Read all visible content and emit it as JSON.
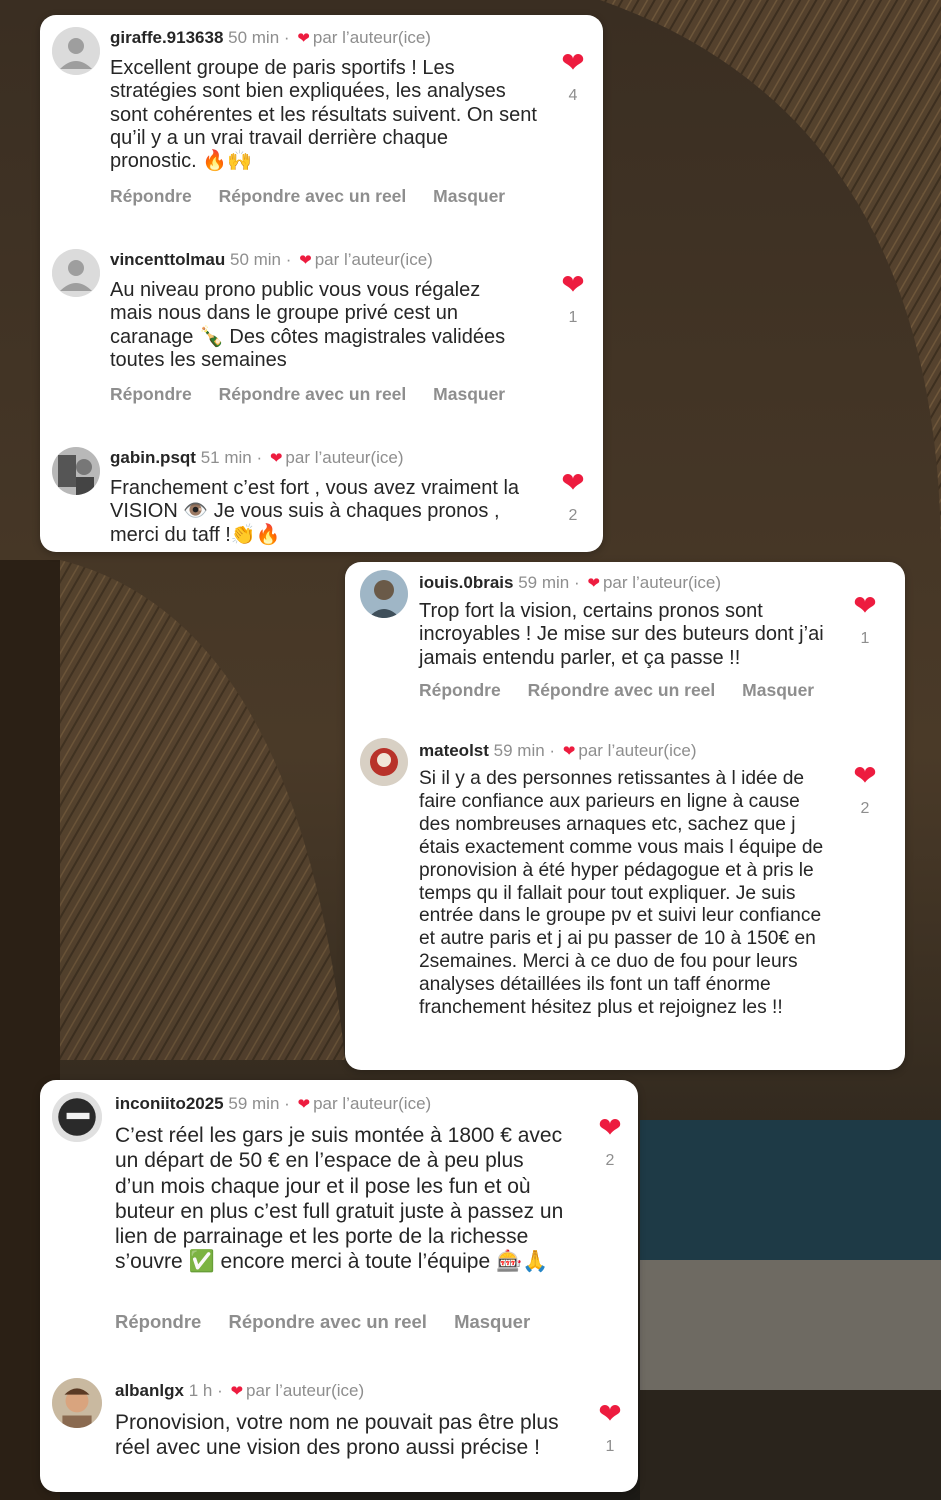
{
  "labels": {
    "reply": "Répondre",
    "reply_reel": "Répondre avec un reel",
    "hide": "Masquer",
    "liked_by_author": "par l’auteur(ice)"
  },
  "comments": [
    {
      "username": "giraffe.913638",
      "time": "50 min",
      "text": "Excellent groupe de paris sportifs ! Les stratégies sont bien expliquées, les analyses sont cohérentes et les résultats suivent. On sent qu’il y a un vrai travail derrière chaque pronostic. 🔥🙌",
      "likes": "4",
      "avatar": "default-avatar-icon"
    },
    {
      "username": "vincenttolmau",
      "time": "50 min",
      "text": "Au niveau prono public vous vous régalez mais nous dans le groupe privé cest un caranage 🍾 Des côtes magistrales validées toutes les semaines",
      "likes": "1",
      "avatar": "default-avatar-icon"
    },
    {
      "username": "gabin.psqt",
      "time": "51 min",
      "text": "Franchement c’est fort , vous avez vraiment la VISION 👁️ Je vous suis à chaques pronos , merci du taff !👏🔥",
      "likes": "2",
      "avatar": "photo-avatar"
    },
    {
      "username": "iouis.0brais",
      "time": "59 min",
      "text": "Trop fort la vision, certains pronos sont incroyables ! Je mise sur des buteurs dont j’ai jamais entendu parler, et ça passe !!",
      "likes": "1",
      "avatar": "photo-avatar"
    },
    {
      "username": "mateolst",
      "time": "59 min",
      "text": "Si il y a des personnes retissantes à l idée de faire confiance aux parieurs en ligne à cause des nombreuses arnaques etc, sachez que j étais exactement comme vous mais l équipe de pronovision à été hyper pédagogue et à pris le temps qu il fallait pour tout expliquer. Je suis entrée dans le groupe pv et suivi leur confiance et autre paris et j ai pu passer de 10 à 150€ en 2semaines. Merci à ce duo de fou pour leurs analyses détaillées ils font un taff énorme franchement hésitez plus et rejoignez les !!",
      "likes": "2",
      "avatar": "photo-avatar"
    },
    {
      "username": "inconiito2025",
      "time": "59 min",
      "text": "C’est réel les gars je suis montée à  1800 € avec un départ de 50 € en l’espace de à peu plus d’un mois chaque jour et il pose les fun et où buteur en plus c’est full gratuit juste à passez un lien de parrainage et les porte de la richesse s’ouvre ✅ encore merci à toute l’équipe 🎰🙏",
      "likes": "2",
      "avatar": "photo-avatar"
    },
    {
      "username": "albanlgx",
      "time": "1 h",
      "text": "Pronovision, votre nom ne pouvait pas être plus réel avec une vision des prono aussi précise !",
      "likes": "1",
      "avatar": "photo-avatar"
    }
  ],
  "colors": {
    "heart": "#ed1c3f",
    "secondary_text": "#8e8e8e",
    "primary_text": "#262626"
  }
}
